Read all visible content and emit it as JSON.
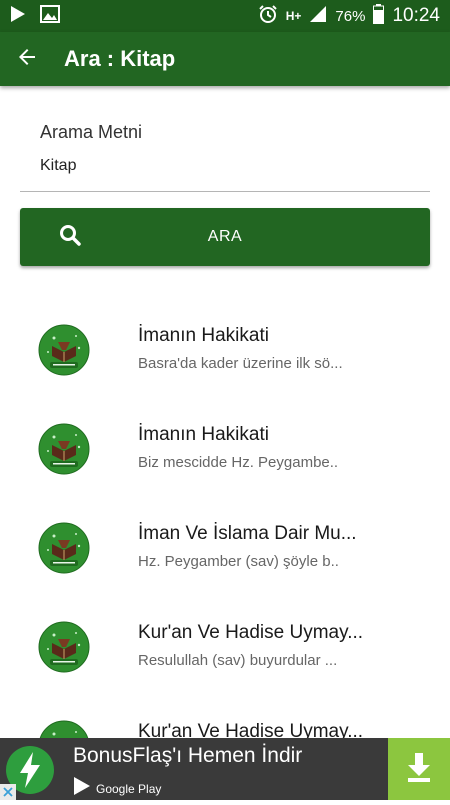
{
  "status_bar": {
    "network": "H+",
    "battery": "76%",
    "time": "10:24"
  },
  "app_bar": {
    "title": "Ara : Kitap"
  },
  "search": {
    "label": "Arama Metni",
    "value": "Kitap",
    "button_label": "ARA"
  },
  "results": [
    {
      "title": "İmanın Hakikati",
      "subtitle": "Basra'da kader üzerine ilk sö..."
    },
    {
      "title": "İmanın Hakikati",
      "subtitle": "Biz mescidde Hz. Peygambe.."
    },
    {
      "title": "İman Ve İslama Dair Mu...",
      "subtitle": "Hz. Peygamber (sav) şöyle b.."
    },
    {
      "title": "Kur'an Ve Hadise Uymay...",
      "subtitle": "Resulullah (sav) buyurdular ..."
    },
    {
      "title": "Kur'an Ve Hadise Uymay...",
      "subtitle": ""
    }
  ],
  "ad": {
    "title": "BonusFlaş'ı Hemen İndir",
    "store": "Google Play"
  },
  "colors": {
    "status_bar": "#1d5c1c",
    "app_bar": "#226622",
    "button": "#226622",
    "ad_background": "#3a3a3a",
    "ad_download": "#8cc63f"
  }
}
